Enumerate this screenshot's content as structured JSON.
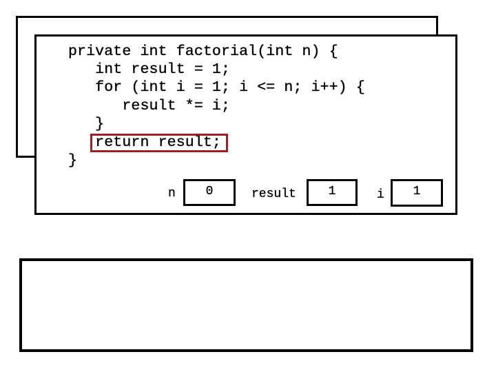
{
  "code": {
    "lines": [
      "private int factorial(int n) {",
      "   int result = 1;",
      "   for (int i = 1; i <= n; i++) {",
      "      result *= i;",
      "   }",
      "   return result;",
      "}"
    ],
    "highlighted_line_index": 5,
    "highlight_color": "#a31f1f"
  },
  "variables": [
    {
      "name": "n",
      "value": "0"
    },
    {
      "name": "result",
      "value": "1"
    },
    {
      "name": "i",
      "value": "1"
    }
  ],
  "output_box": {
    "text": ""
  }
}
